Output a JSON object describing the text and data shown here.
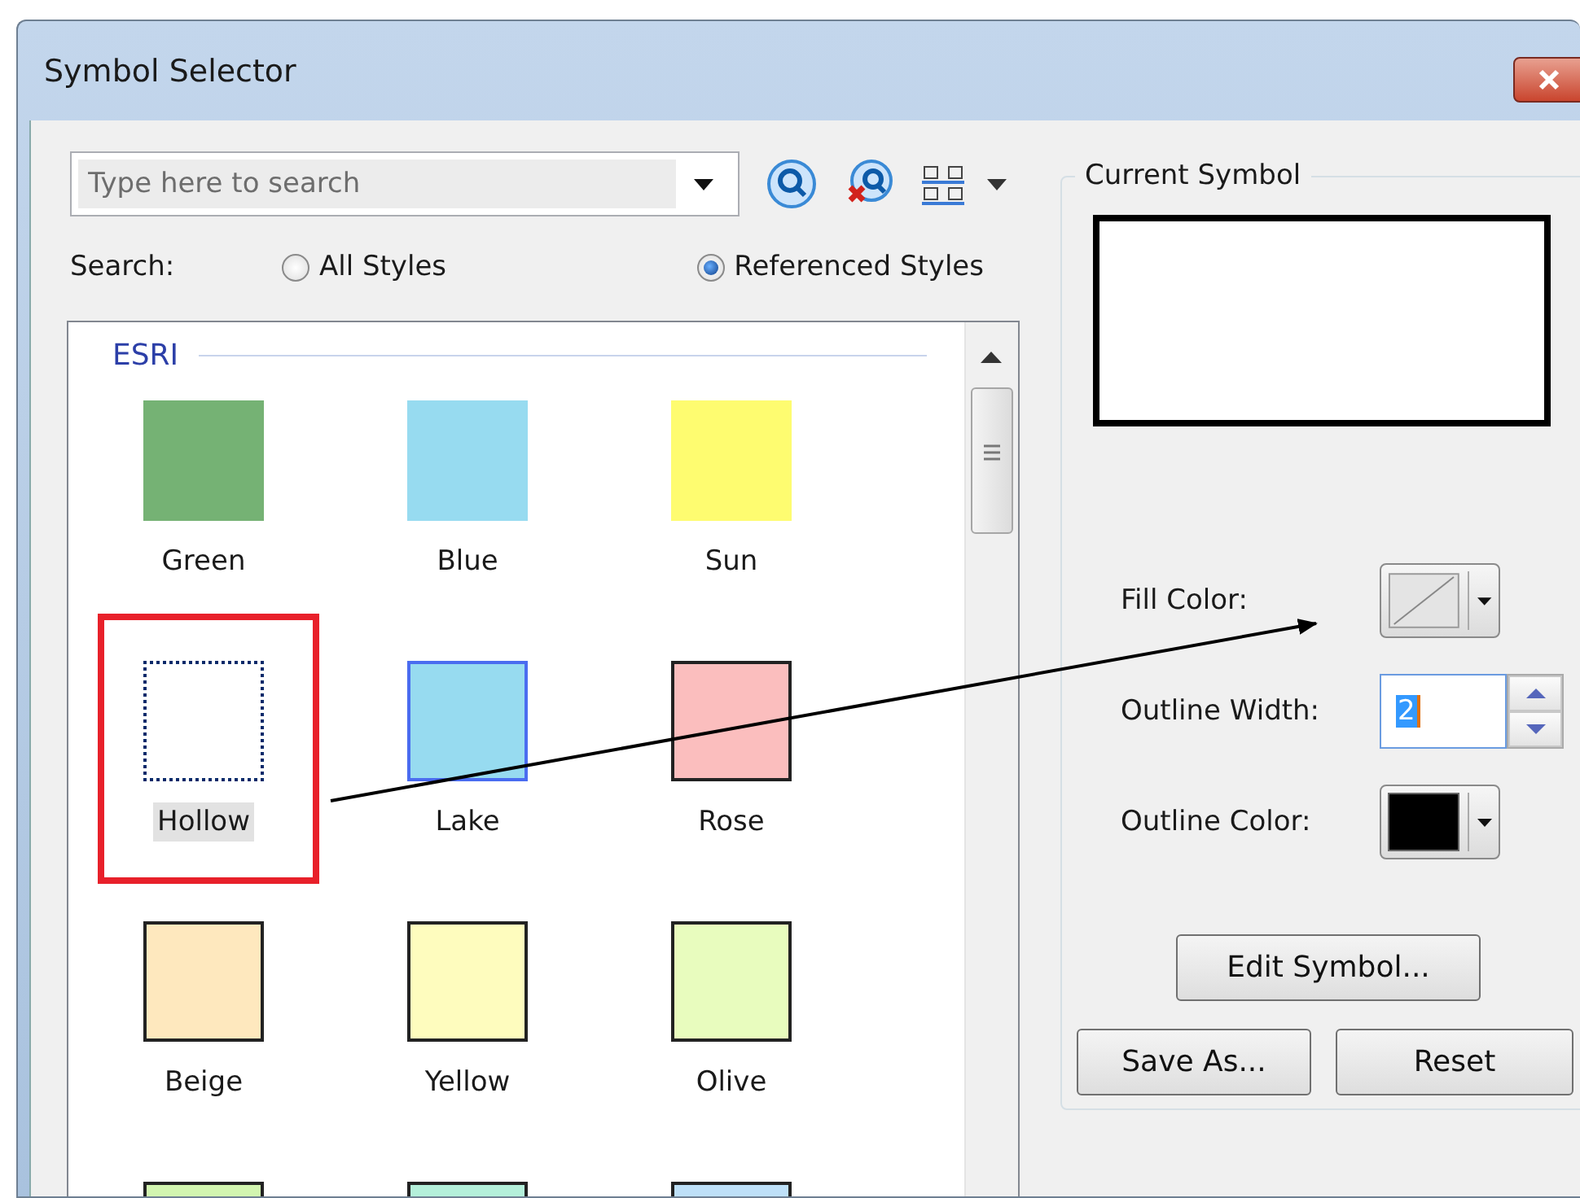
{
  "window": {
    "title": "Symbol Selector"
  },
  "search": {
    "placeholder": "Type here to search"
  },
  "search_scope": {
    "label": "Search:",
    "options": [
      {
        "label": "All Styles",
        "selected": false
      },
      {
        "label": "Referenced Styles",
        "selected": true
      }
    ]
  },
  "symbol_list": {
    "group": "ESRI",
    "symbols": [
      {
        "name": "Green",
        "kind": "plain",
        "color": "#75b274",
        "selected": false
      },
      {
        "name": "Blue",
        "kind": "plain",
        "color": "#97dbf0",
        "selected": false
      },
      {
        "name": "Sun",
        "kind": "plain",
        "color": "#fefc70",
        "selected": false
      },
      {
        "name": "Hollow",
        "kind": "hollow",
        "selected": true
      },
      {
        "name": "Lake",
        "kind": "hovered",
        "color": "#97dbf0",
        "selected": false
      },
      {
        "name": "Rose",
        "kind": "outlined",
        "color": "#fbbebe",
        "selected": false
      },
      {
        "name": "Beige",
        "kind": "outlined",
        "color": "#fee8be",
        "selected": false
      },
      {
        "name": "Yellow",
        "kind": "outlined",
        "color": "#fefcbe",
        "selected": false
      },
      {
        "name": "Olive",
        "kind": "outlined",
        "color": "#e8fcbe",
        "selected": false
      },
      {
        "kind": "outlined",
        "color": "#d2f5b0",
        "selected": false
      },
      {
        "kind": "outlined",
        "color": "#b4f0da",
        "selected": false
      },
      {
        "kind": "outlined",
        "color": "#bee0f8",
        "selected": false
      }
    ]
  },
  "current_symbol": {
    "title": "Current Symbol"
  },
  "properties": [
    {
      "kind": "fill",
      "label": "Fill Color:"
    },
    {
      "kind": "width",
      "label": "Outline Width:",
      "value": "2"
    },
    {
      "kind": "color",
      "label": "Outline Color:",
      "color": "#000000"
    }
  ],
  "buttons": [
    "Edit Symbol...",
    "Save As...",
    "Reset"
  ]
}
